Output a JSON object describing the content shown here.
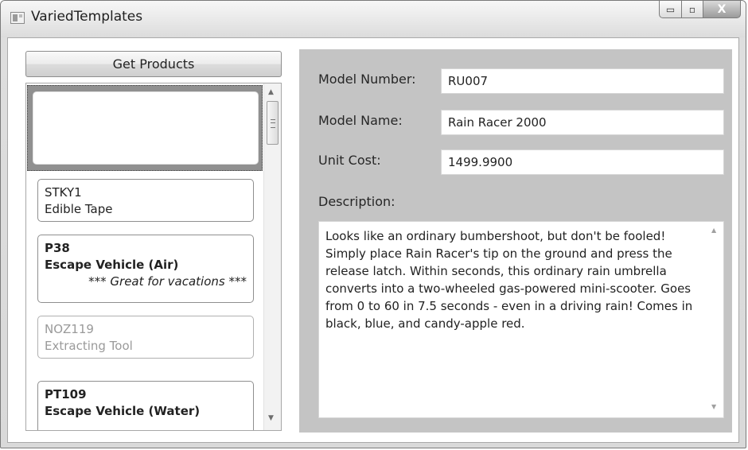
{
  "window": {
    "title": "VariedTemplates",
    "controls": {
      "minimize": "▭",
      "maximize": "▫",
      "close": "X"
    }
  },
  "toolbar": {
    "get_products_label": "Get Products"
  },
  "product_list": [
    {
      "code": "STKY1",
      "name": "Edible Tape",
      "note": "",
      "style": "normal"
    },
    {
      "code": "P38",
      "name": "Escape Vehicle (Air)",
      "note": "*** Great for vacations ***",
      "style": "bold"
    },
    {
      "code": "NOZ119",
      "name": "Extracting Tool",
      "note": "",
      "style": "dim"
    },
    {
      "code": "PT109",
      "name": "Escape Vehicle (Water)",
      "note": "",
      "style": "bold"
    }
  ],
  "details": {
    "model_number_label": "Model Number:",
    "model_number": "RU007",
    "model_name_label": "Model Name:",
    "model_name": "Rain Racer 2000",
    "unit_cost_label": "Unit Cost:",
    "unit_cost": "1499.9900",
    "description_label": "Description:",
    "description": "Looks like an ordinary bumbershoot, but don't be fooled! Simply place Rain Racer's tip on the ground and press the release latch. Within seconds, this ordinary rain umbrella converts into a two-wheeled gas-powered mini-scooter. Goes from 0 to 60 in 7.5 seconds - even in a driving rain! Comes in black, blue, and candy-apple red."
  },
  "colors": {
    "detail_panel": "#c4c4c4",
    "selection": "#909090"
  }
}
